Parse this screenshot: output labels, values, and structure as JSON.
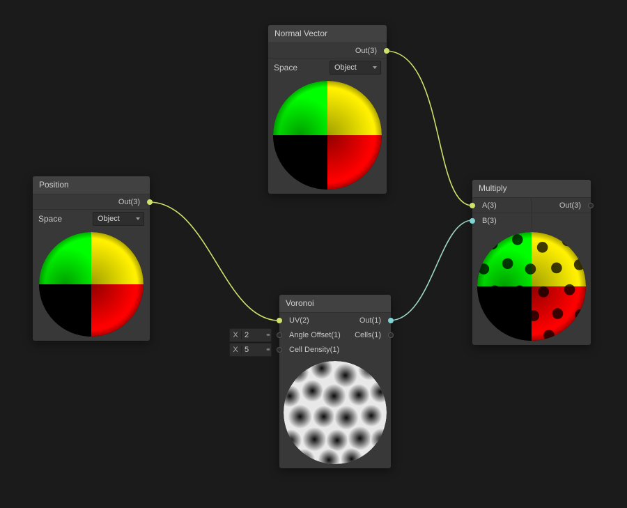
{
  "nodes": {
    "position": {
      "title": "Position",
      "out_label": "Out(3)",
      "space_label": "Space",
      "space_value": "Object"
    },
    "normal": {
      "title": "Normal Vector",
      "out_label": "Out(3)",
      "space_label": "Space",
      "space_value": "Object"
    },
    "voronoi": {
      "title": "Voronoi",
      "in_uv": "UV(2)",
      "in_angle": "Angle Offset(1)",
      "in_density": "Cell Density(1)",
      "out_main": "Out(1)",
      "out_cells": "Cells(1)",
      "float_angle": {
        "prefix": "X",
        "value": "2"
      },
      "float_density": {
        "prefix": "X",
        "value": "5"
      }
    },
    "multiply": {
      "title": "Multiply",
      "in_a": "A(3)",
      "in_b": "B(3)",
      "out_label": "Out(3)"
    }
  }
}
